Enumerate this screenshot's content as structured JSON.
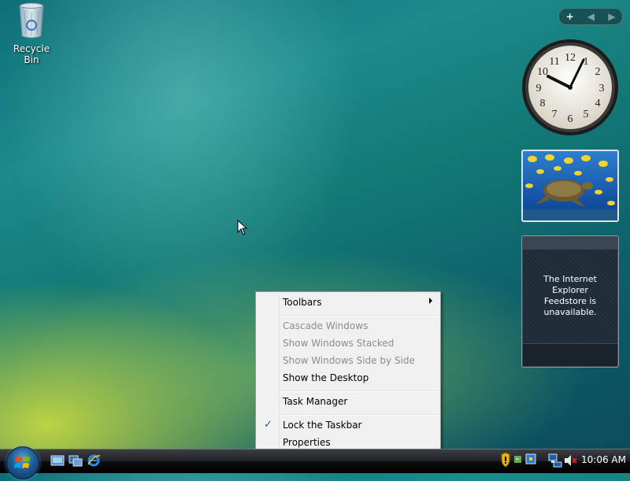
{
  "desktop": {
    "icons": [
      {
        "label": "Recycle Bin",
        "icon": "recycle-bin-icon"
      }
    ]
  },
  "sidebar": {
    "controls": {
      "add": "+",
      "prev": "◀",
      "next": "▶"
    },
    "clock_numbers": [
      "12",
      "1",
      "2",
      "3",
      "4",
      "5",
      "6",
      "7",
      "8",
      "9",
      "10",
      "11"
    ],
    "feed_message": [
      "The Internet Explorer",
      "Feedstore is",
      "unavailable."
    ]
  },
  "context_menu": {
    "items": [
      {
        "label": "Toolbars",
        "submenu": true,
        "enabled": true
      },
      {
        "label": "Cascade Windows",
        "enabled": false
      },
      {
        "label": "Show Windows Stacked",
        "enabled": false
      },
      {
        "label": "Show Windows Side by Side",
        "enabled": false
      },
      {
        "label": "Show the Desktop",
        "enabled": true
      },
      {
        "label": "Task Manager",
        "enabled": true
      },
      {
        "label": "Lock the Taskbar",
        "checked": true,
        "enabled": true
      },
      {
        "label": "Properties",
        "enabled": true
      }
    ]
  },
  "taskbar": {
    "quick_launch": [
      "show-desktop-icon",
      "switch-windows-icon",
      "internet-explorer-icon"
    ],
    "tray_icons": [
      "security-shield-icon",
      "sync-icon",
      "windows-update-icon",
      "network-icon",
      "volume-muted-icon"
    ],
    "time": "10:06 AM"
  },
  "colors": {
    "menu_bg": "#f0f0f0",
    "disabled_text": "#8d8d8d",
    "taskbar": "#1e2126"
  }
}
